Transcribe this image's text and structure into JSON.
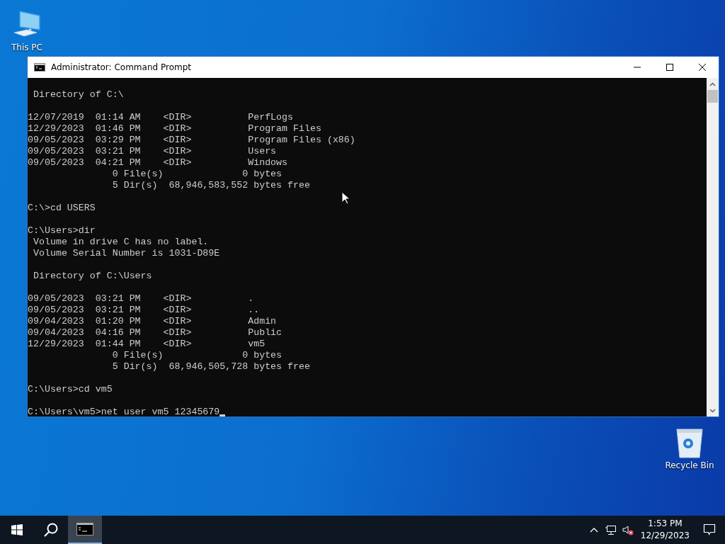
{
  "desktop_icons": [
    {
      "label": "This PC",
      "kind": "pc"
    },
    {
      "label": "Recycle Bin",
      "kind": "bin"
    }
  ],
  "window": {
    "title": "Administrator: Command Prompt"
  },
  "console": {
    "blocks": [
      [
        " Directory of C:\\"
      ],
      [
        "12/07/2019  01:14 AM    <DIR>          PerfLogs",
        "12/29/2023  01:46 PM    <DIR>          Program Files",
        "09/05/2023  03:29 PM    <DIR>          Program Files (x86)",
        "09/05/2023  03:21 PM    <DIR>          Users",
        "09/05/2023  04:21 PM    <DIR>          Windows",
        "               0 File(s)              0 bytes",
        "               5 Dir(s)  68,946,583,552 bytes free"
      ],
      [
        "C:\\>cd USERS"
      ],
      [
        "C:\\Users>dir",
        " Volume in drive C has no label.",
        " Volume Serial Number is 1031-D89E"
      ],
      [
        " Directory of C:\\Users"
      ],
      [
        "09/05/2023  03:21 PM    <DIR>          .",
        "09/05/2023  03:21 PM    <DIR>          ..",
        "09/04/2023  01:20 PM    <DIR>          Admin",
        "09/04/2023  04:16 PM    <DIR>          Public",
        "12/29/2023  01:44 PM    <DIR>          vm5",
        "               0 File(s)              0 bytes",
        "               5 Dir(s)  68,946,505,728 bytes free"
      ],
      [
        "C:\\Users>cd vm5"
      ],
      [
        "C:\\Users\\vm5>net user vm5 12345679"
      ]
    ]
  },
  "taskbar": {
    "time": "1:53 PM",
    "date": "12/29/2023"
  }
}
